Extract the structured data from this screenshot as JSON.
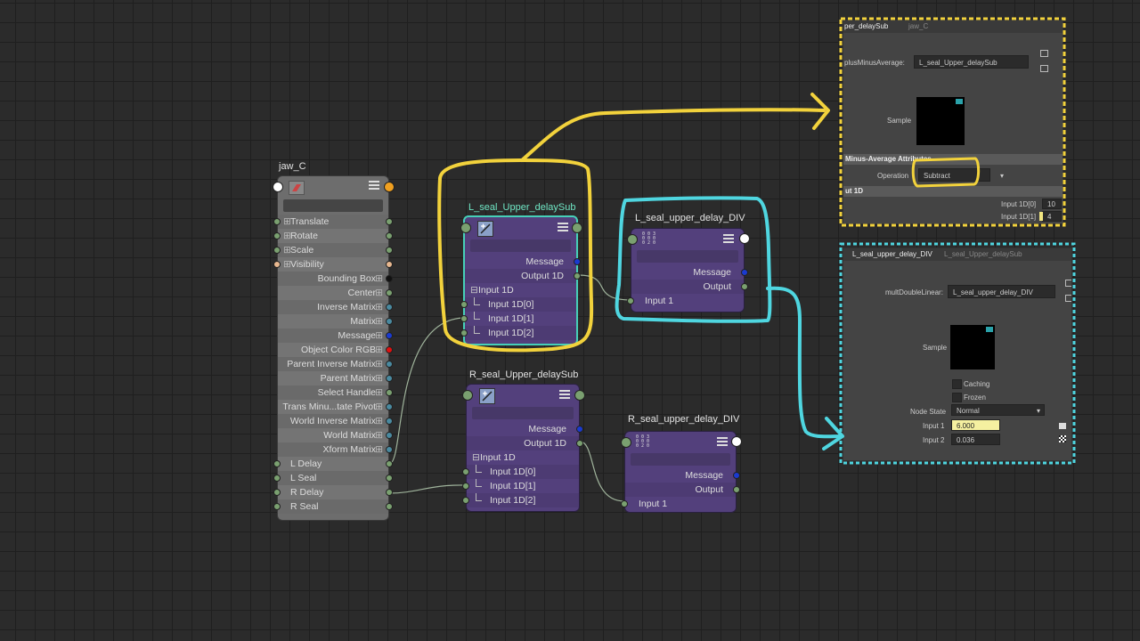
{
  "jaw_node": {
    "title": "jaw_C",
    "attrs_left": [
      "Translate",
      "Rotate",
      "Scale",
      "Visibility"
    ],
    "attrs_right": [
      "Bounding Box",
      "Center",
      "Inverse Matrix",
      "Matrix",
      "Message",
      "Object Color RGB",
      "Parent Inverse Matrix",
      "Parent Matrix",
      "Select Handle",
      "Trans Minu...tate Pivot",
      "World Inverse Matrix",
      "World Matrix",
      "Xform Matrix"
    ],
    "attrs_custom": [
      "L Delay",
      "L Seal",
      "R Delay",
      "R Seal"
    ]
  },
  "l_sub_node": {
    "title": "L_seal_Upper_delaySub",
    "message": "Message",
    "output": "Output 1D",
    "input_group": "Input 1D",
    "inputs": [
      "Input 1D[0]",
      "Input 1D[1]",
      "Input 1D[2]"
    ]
  },
  "r_sub_node": {
    "title": "R_seal_Upper_delaySub",
    "message": "Message",
    "output": "Output 1D",
    "input_group": "Input 1D",
    "inputs": [
      "Input 1D[0]",
      "Input 1D[1]",
      "Input 1D[2]"
    ]
  },
  "l_div_node": {
    "title": "L_seal_upper_delay_DIV",
    "icon_glyph": "0 0 3\n0 0 0\n0 2 0",
    "message": "Message",
    "output": "Output",
    "input": "Input 1"
  },
  "r_div_node": {
    "title": "R_seal_upper_delay_DIV",
    "icon_glyph": "0 0 3\n0 0 0\n0 2 0",
    "message": "Message",
    "output": "Output",
    "input": "Input 1"
  },
  "ae_top": {
    "tabs": [
      "per_delaySub",
      "jaw_C"
    ],
    "type_label": "plusMinusAverage:",
    "name_value": "L_seal_Upper_delaySub",
    "sample_label": "Sample",
    "section": "Minus-Average Attributes",
    "operation_label": "Operation",
    "operation_value": "Subtract",
    "input_section": "ut 1D",
    "inputs": [
      {
        "label": "Input 1D[0]",
        "value": "10"
      },
      {
        "label": "Input 1D[1]",
        "value": "4"
      }
    ]
  },
  "ae_bottom": {
    "tabs": [
      "L_seal_upper_delay_DIV",
      "L_seal_Upper_delaySub"
    ],
    "type_label": "multDoubleLinear:",
    "name_value": "L_seal_upper_delay_DIV",
    "sample_label": "Sample",
    "caching_label": "Caching",
    "frozen_label": "Frozen",
    "node_state_label": "Node State",
    "node_state_value": "Normal",
    "input1_label": "Input 1",
    "input1_value": "6.000",
    "input2_label": "Input 2",
    "input2_value": "0.036"
  },
  "colors": {
    "annotation_yellow": "#f2d23c",
    "annotation_cyan": "#4fd6e0",
    "selection_teal": "#46d0b8",
    "node_purple": "#53407c"
  }
}
